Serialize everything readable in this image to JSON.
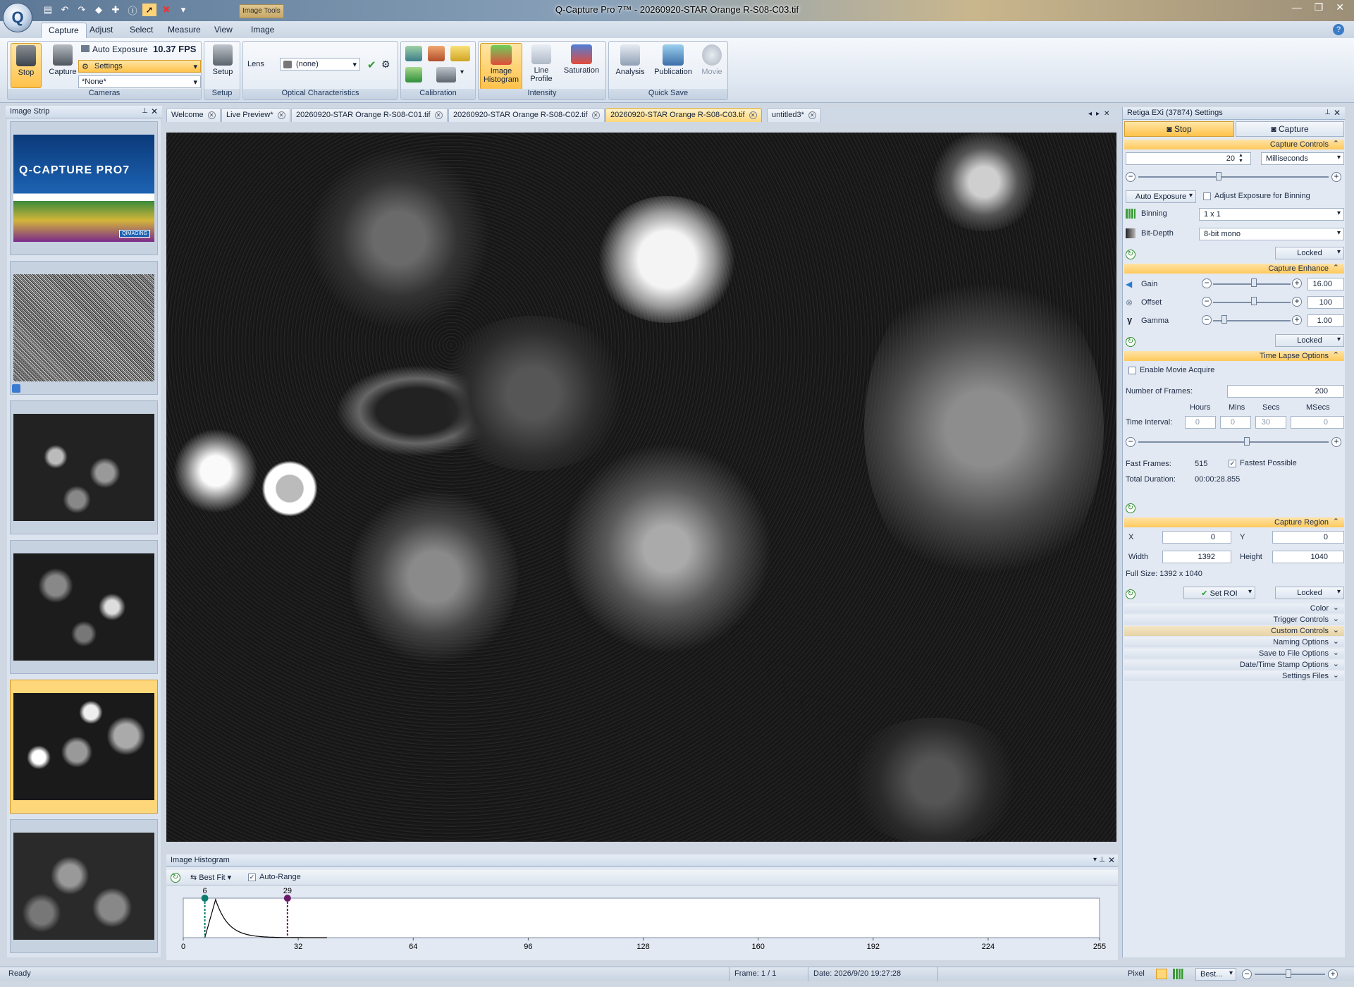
{
  "window": {
    "title": "Q-Capture Pro 7™ - 20260920-STAR Orange R-S08-C03.tif",
    "context_tab": "Image Tools"
  },
  "ribbon": {
    "tabs": [
      "Capture",
      "Adjust",
      "Select",
      "Measure",
      "View",
      "Image"
    ],
    "active_tab": "Capture",
    "cameras": {
      "stop": "Stop",
      "capture": "Capture",
      "auto_exposure": "Auto Exposure",
      "fps": "10.37 FPS",
      "settings": "Settings",
      "preset": "*None*",
      "label": "Cameras"
    },
    "setup": {
      "button": "Setup",
      "label": "Setup"
    },
    "optical": {
      "lens_label": "Lens",
      "lens_value": "(none)",
      "label": "Optical Characteristics"
    },
    "calibration": {
      "label": "Calibration"
    },
    "intensity": {
      "image_histogram": "Image Histogram",
      "line_profile": "Line Profile",
      "saturation": "Saturation",
      "label": "Intensity"
    },
    "quicksave": {
      "analysis": "Analysis",
      "publication": "Publication",
      "movie": "Movie",
      "label": "Quick Save"
    }
  },
  "image_strip": {
    "title": "Image Strip",
    "splash_title": "Q-CAPTURE PRO7",
    "splash_brand": "QIMAGING"
  },
  "doc_tabs": [
    "Welcome",
    "Live Preview*",
    "20260920-STAR Orange R-S08-C01.tif",
    "20260920-STAR Orange R-S08-C02.tif",
    "20260920-STAR Orange R-S08-C03.tif",
    "untitled3*"
  ],
  "active_doc_tab": 4,
  "histogram": {
    "title": "Image Histogram",
    "fit": "Best Fit",
    "auto_range": "Auto-Range",
    "low_marker": "6",
    "high_marker": "29",
    "ticks": [
      "0",
      "32",
      "64",
      "96",
      "128",
      "160",
      "192",
      "224",
      "255"
    ],
    "low_value": 6,
    "high_value": 29,
    "peak_value": 9,
    "x_min": 0,
    "x_max": 255
  },
  "settings": {
    "title": "Retiga EXi (37874) Settings",
    "stop": "Stop",
    "capture": "Capture",
    "capture_controls": "Capture Controls",
    "exposure_value": "20",
    "exposure_unit": "Milliseconds",
    "auto_exposure": "Auto Exposure",
    "adjust_binning": "Adjust Exposure for Binning",
    "binning_label": "Binning",
    "binning_value": "1 x 1",
    "bitdepth_label": "Bit-Depth",
    "bitdepth_value": "8-bit mono",
    "locked": "Locked",
    "capture_enhance": "Capture Enhance",
    "gain_label": "Gain",
    "gain_value": "16.00",
    "offset_label": "Offset",
    "offset_value": "100",
    "gamma_label": "Gamma",
    "gamma_value": "1.00",
    "time_lapse": "Time Lapse Options",
    "enable_movie": "Enable Movie Acquire",
    "num_frames_label": "Number of Frames:",
    "num_frames": "200",
    "hours": "Hours",
    "mins": "Mins",
    "secs": "Secs",
    "msecs": "MSecs",
    "time_interval": "Time Interval:",
    "ti_h": "0",
    "ti_m": "0",
    "ti_s": "30",
    "ti_ms": "0",
    "fast_frames_label": "Fast Frames:",
    "fast_frames": "515",
    "fastest_possible": "Fastest Possible",
    "total_duration_label": "Total Duration:",
    "total_duration": "00:00:28.855",
    "capture_region": "Capture Region",
    "x_label": "X",
    "x_value": "0",
    "y_label": "Y",
    "y_value": "0",
    "width_label": "Width",
    "width_value": "1392",
    "height_label": "Height",
    "height_value": "1040",
    "full_size": "Full Size: 1392 x 1040",
    "set_roi": "Set ROI",
    "collapsed": [
      "Color",
      "Trigger Controls",
      "Custom Controls",
      "Naming Options",
      "Save to File Options",
      "Date/Time Stamp Options",
      "Settings Files"
    ]
  },
  "status": {
    "ready": "Ready",
    "frame": "Frame: 1 / 1",
    "date": "Date: 2026/9/20 19:27:28",
    "pixel": "Pixel",
    "zoom": "Best..."
  }
}
